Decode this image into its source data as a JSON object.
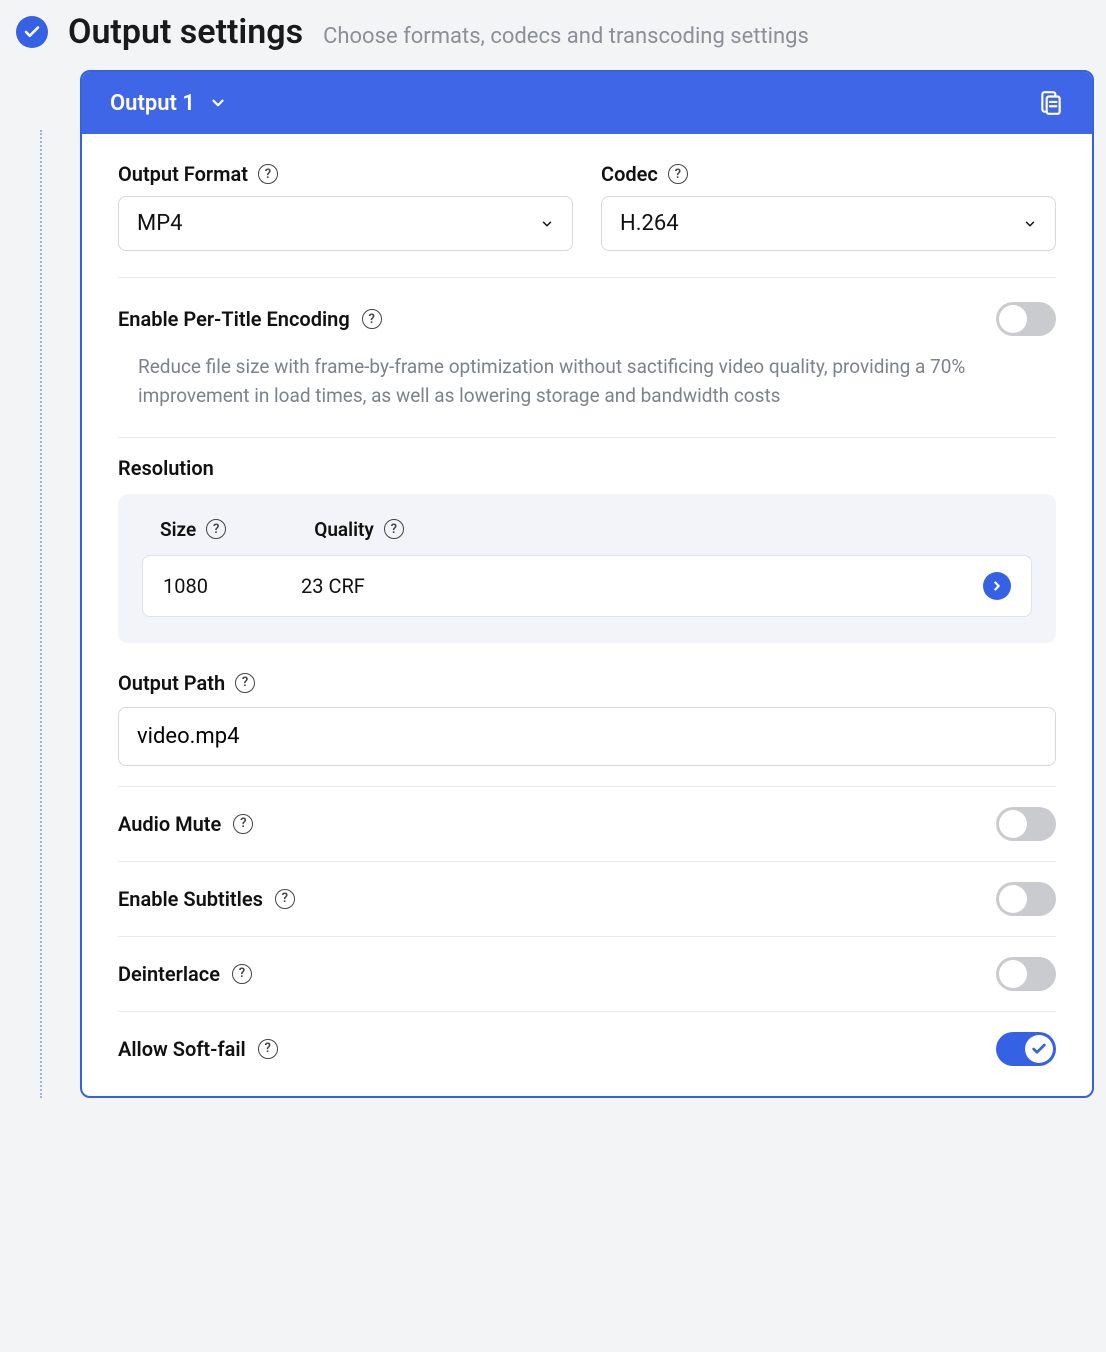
{
  "header": {
    "title": "Output settings",
    "subtitle": "Choose formats, codecs and transcoding settings"
  },
  "card": {
    "tab_label": "Output 1"
  },
  "format": {
    "label": "Output Format",
    "value": "MP4"
  },
  "codec": {
    "label": "Codec",
    "value": "H.264"
  },
  "per_title": {
    "label": "Enable Per-Title Encoding",
    "description": "Reduce file size with frame-by-frame optimization without sactificing video quality, providing a 70% improvement in load times, as well as lowering storage and bandwidth costs",
    "enabled": false
  },
  "resolution": {
    "title": "Resolution",
    "headers": {
      "size": "Size",
      "quality": "Quality"
    },
    "row": {
      "size": "1080",
      "quality": "23 CRF"
    }
  },
  "output_path": {
    "label": "Output Path",
    "value": "video.mp4"
  },
  "toggles": {
    "audio_mute": {
      "label": "Audio Mute",
      "enabled": false
    },
    "subtitles": {
      "label": "Enable Subtitles",
      "enabled": false
    },
    "deinterlace": {
      "label": "Deinterlace",
      "enabled": false
    },
    "soft_fail": {
      "label": "Allow Soft-fail",
      "enabled": true
    }
  }
}
